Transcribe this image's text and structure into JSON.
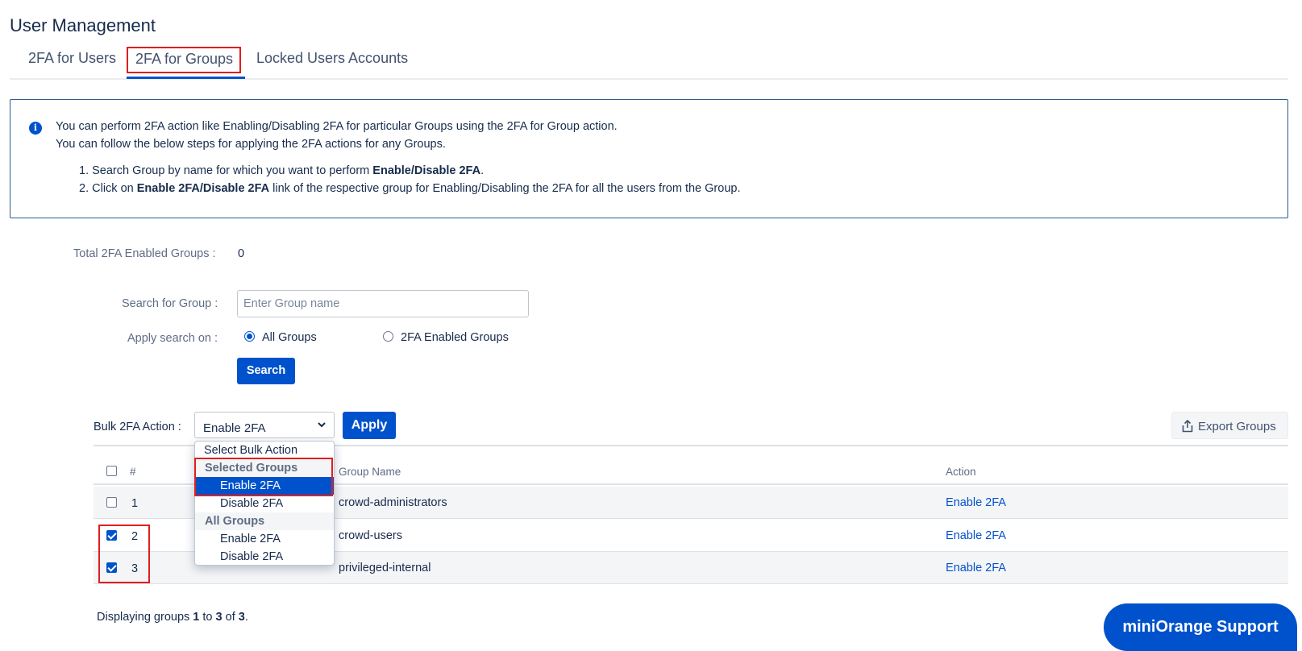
{
  "page": {
    "title": "User Management"
  },
  "tabs": [
    {
      "label": "2FA for Users"
    },
    {
      "label": "2FA for Groups",
      "active": true
    },
    {
      "label": "Locked Users Accounts"
    }
  ],
  "info": {
    "line1": "You can perform 2FA action like Enabling/Disabling 2FA for particular Groups using the 2FA for Group action.",
    "line2": "You can follow the below steps for applying the 2FA actions for any Groups.",
    "step1_prefix": "1. Search Group by name for which you want to perform ",
    "step1_bold": "Enable/Disable 2FA",
    "step1_suffix": ".",
    "step2_prefix": "2. Click on ",
    "step2_bold": "Enable 2FA/Disable 2FA",
    "step2_suffix": " link of the respective group for Enabling/Disabling the 2FA for all the users from the Group."
  },
  "stats": {
    "total_label": "Total 2FA Enabled Groups :",
    "total_value": "0"
  },
  "search": {
    "label": "Search for Group :",
    "placeholder": "Enter Group name",
    "apply_label": "Apply search on :",
    "option_all": "All Groups",
    "option_enabled": "2FA Enabled Groups",
    "selected": "All Groups",
    "button": "Search"
  },
  "bulk": {
    "label": "Bulk 2FA Action :",
    "selected": "Enable 2FA",
    "apply_button": "Apply",
    "export_button": "Export Groups",
    "dropdown": {
      "placeholder": "Select Bulk Action",
      "group_selected": "Selected Groups",
      "selected_enable": "Enable 2FA",
      "selected_disable": "Disable 2FA",
      "group_all": "All Groups",
      "all_enable": "Enable 2FA",
      "all_disable": "Disable 2FA"
    }
  },
  "table": {
    "headers": {
      "num": "#",
      "name": "Group Name",
      "action": "Action"
    },
    "rows": [
      {
        "num": "1",
        "name": "crowd-administrators",
        "action": "Enable 2FA",
        "checked": false
      },
      {
        "num": "2",
        "name": "crowd-users",
        "action": "Enable 2FA",
        "checked": true
      },
      {
        "num": "3",
        "name": "privileged-internal",
        "action": "Enable 2FA",
        "checked": true
      }
    ]
  },
  "footer": {
    "prefix": "Displaying groups ",
    "from": "1",
    "to_word": " to ",
    "to": "3",
    "of_word": " of ",
    "total": "3",
    "suffix": "."
  },
  "support": {
    "label": "miniOrange Support"
  },
  "colors": {
    "primary": "#0052cc",
    "highlight": "#e01e1e",
    "text": "#172b4d"
  }
}
